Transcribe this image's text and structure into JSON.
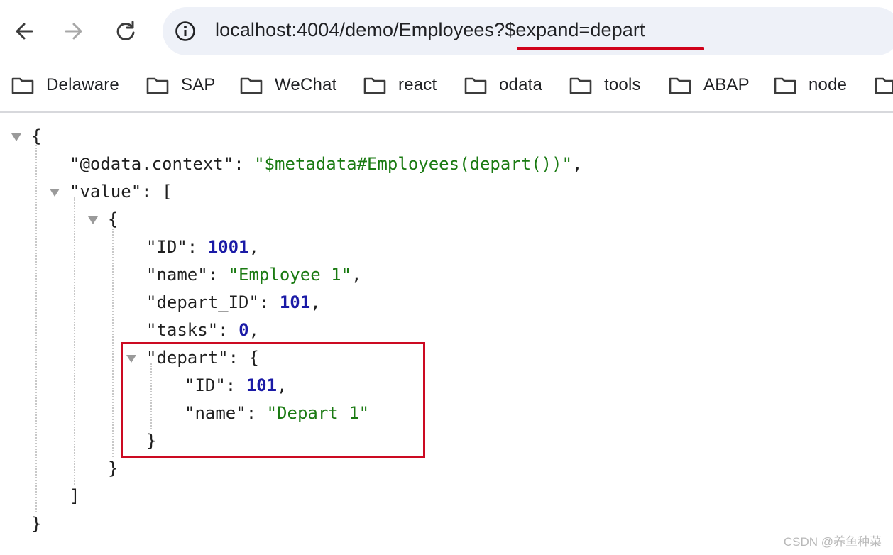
{
  "toolbar": {
    "back_icon": "arrow-left-icon",
    "forward_icon": "arrow-right-icon",
    "reload_icon": "reload-icon",
    "site_info_icon": "info-icon",
    "url": "localhost:4004/demo/Employees?$expand=depart"
  },
  "bookmarks": [
    {
      "label": "Delaware",
      "icon": "folder-icon"
    },
    {
      "label": "SAP",
      "icon": "folder-icon"
    },
    {
      "label": "WeChat",
      "icon": "folder-icon"
    },
    {
      "label": "react",
      "icon": "folder-icon"
    },
    {
      "label": "odata",
      "icon": "folder-icon"
    },
    {
      "label": "tools",
      "icon": "folder-icon"
    },
    {
      "label": "ABAP",
      "icon": "folder-icon"
    },
    {
      "label": "node",
      "icon": "folder-icon"
    }
  ],
  "json": {
    "open_root": "{",
    "context_key": "\"@odata.context\"",
    "context_value": "\"$metadata#Employees(depart())\"",
    "value_key": "\"value\"",
    "open_array": "[",
    "open_item": "{",
    "id_key": "\"ID\"",
    "id_value": "1001",
    "name_key": "\"name\"",
    "name_value": "\"Employee 1\"",
    "depart_id_key": "\"depart_ID\"",
    "depart_id_value": "101",
    "tasks_key": "\"tasks\"",
    "tasks_value": "0",
    "depart_key": "\"depart\"",
    "open_depart": "{",
    "d_id_key": "\"ID\"",
    "d_id_value": "101",
    "d_name_key": "\"name\"",
    "d_name_value": "\"Depart 1\"",
    "close_depart": "}",
    "close_item": "}",
    "close_array": "]",
    "close_root": "}"
  },
  "colors": {
    "string": "#1a7a12",
    "number": "#1a1aa6",
    "annotation_red": "#cc0a22"
  },
  "watermark": "CSDN @养鱼种菜"
}
